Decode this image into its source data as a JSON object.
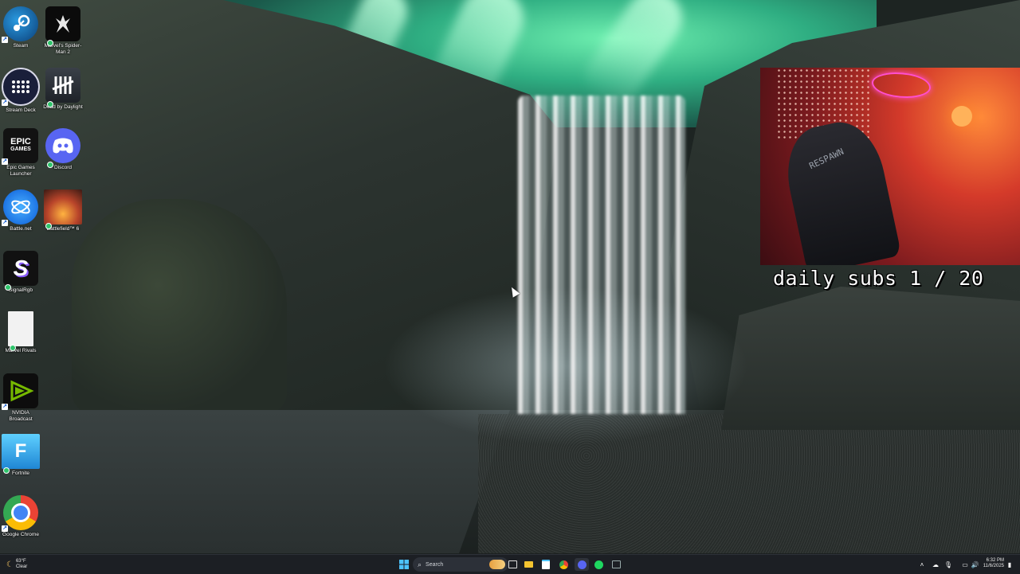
{
  "desktop": {
    "icons": [
      {
        "label": "Steam",
        "icon": "steam-icon",
        "color": "#1b6fb5"
      },
      {
        "label": "Marvel's Spider-Man 2",
        "icon": "spiderman-icon",
        "color": "#111111"
      },
      {
        "label": "Stream Deck",
        "icon": "stream-deck-icon",
        "color": "#1a1f3a"
      },
      {
        "label": "Dead by Daylight",
        "icon": "dead-by-daylight-icon",
        "color": "#2b3138"
      },
      {
        "label": "Epic Games Launcher",
        "icon": "epic-games-icon",
        "color": "#121212"
      },
      {
        "label": "Discord",
        "icon": "discord-icon",
        "color": "#5865f2"
      },
      {
        "label": "Battle.net",
        "icon": "battlenet-icon",
        "color": "#148eff"
      },
      {
        "label": "Battlefield™ 6",
        "icon": "battlefield-icon",
        "color": "#b8442a"
      },
      {
        "label": "SignalRgb",
        "icon": "signalrgb-icon",
        "color": "#ffffff"
      },
      {
        "label": "Marvel Rivals",
        "icon": "file-icon",
        "color": "#f2f2f2"
      },
      {
        "label": "NVIDIA Broadcast",
        "icon": "nvidia-icon",
        "color": "#76b900"
      },
      {
        "label": "Fortnite",
        "icon": "fortnite-icon",
        "color": "#37a8e8"
      },
      {
        "label": "Google Chrome",
        "icon": "chrome-icon",
        "color": "#ea4335"
      }
    ],
    "glyphs": {
      "epic": "EPIC\nGAMES",
      "fortnite": "F",
      "signalrgb": "S"
    }
  },
  "overlay": {
    "subs_text": "daily subs 1 / 20",
    "chair_text": "RESPAWN"
  },
  "taskbar": {
    "search_placeholder": "Search",
    "weather_temp": "63°F",
    "weather_desc": "Clear",
    "time": "6:32 PM",
    "date": "11/6/2025"
  }
}
